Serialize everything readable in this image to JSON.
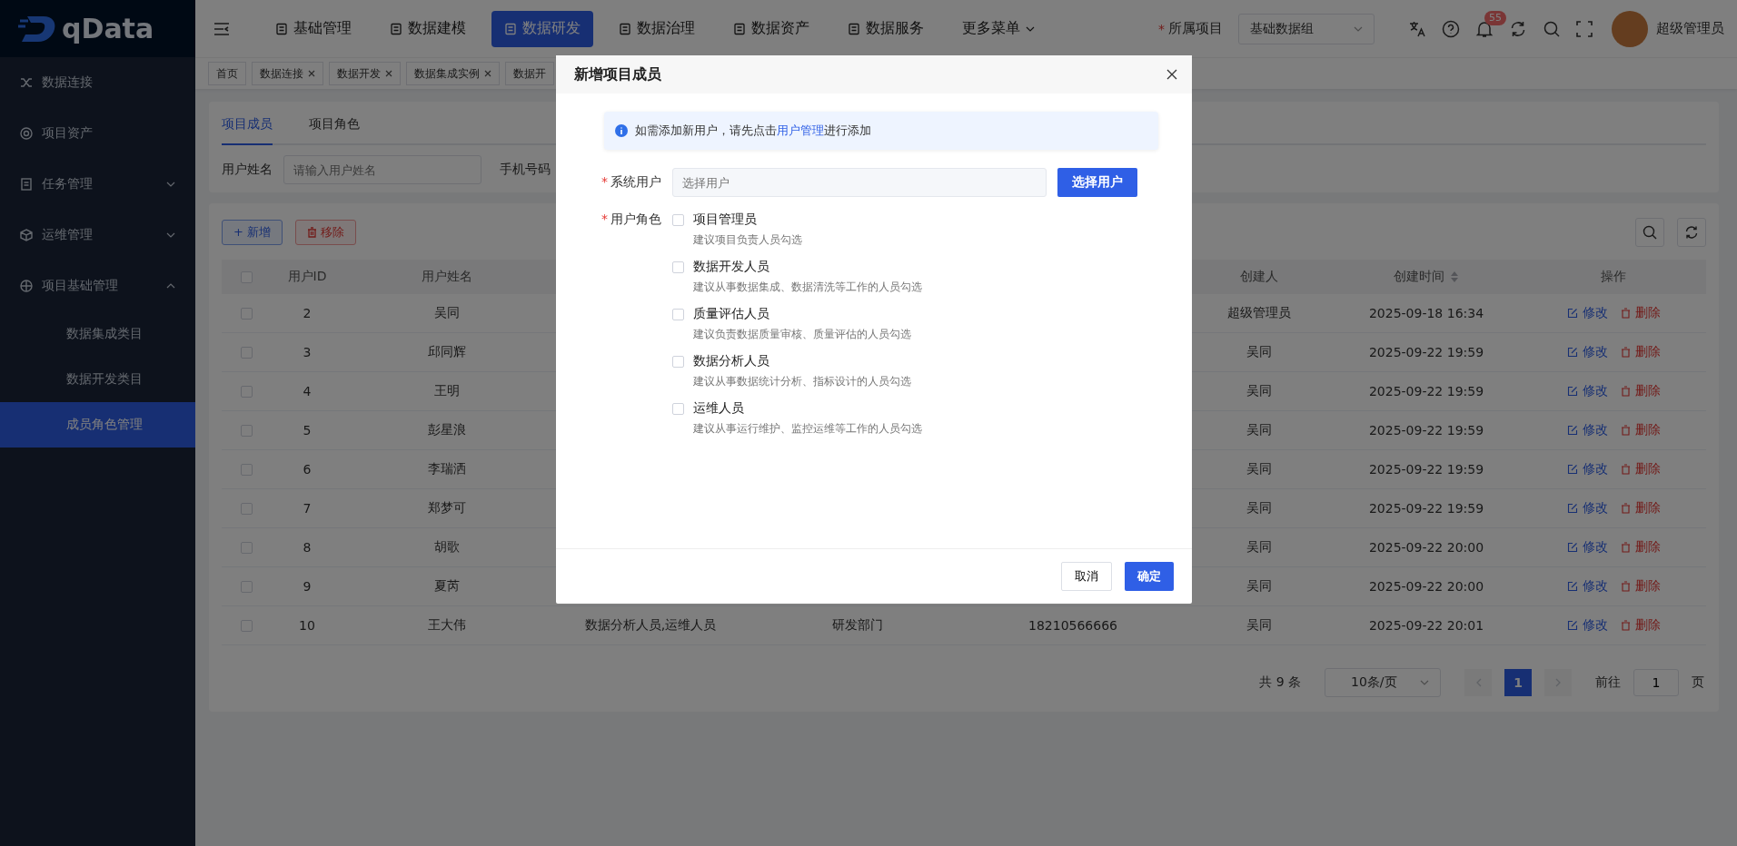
{
  "sidebar": {
    "logo": "qData",
    "items": [
      {
        "label": "数据连接",
        "selected": false
      },
      {
        "label": "项目资产",
        "selected": false
      },
      {
        "label": "任务管理",
        "selected": false,
        "expanded": false
      },
      {
        "label": "运维管理",
        "selected": false,
        "expanded": false
      },
      {
        "label": "项目基础管理",
        "selected": false,
        "expanded": true,
        "children": [
          {
            "label": "数据集成类目",
            "selected": false
          },
          {
            "label": "数据开发类目",
            "selected": false
          },
          {
            "label": "成员角色管理",
            "selected": true
          }
        ]
      }
    ]
  },
  "topbar": {
    "nav": [
      {
        "label": "基础管理",
        "selected": false
      },
      {
        "label": "数据建模",
        "selected": false
      },
      {
        "label": "数据研发",
        "selected": true
      },
      {
        "label": "数据治理",
        "selected": false
      },
      {
        "label": "数据资产",
        "selected": false
      },
      {
        "label": "数据服务",
        "selected": false
      },
      {
        "label": "更多菜单",
        "selected": false,
        "dropdown": true
      }
    ],
    "project_required_mark": "*",
    "project_label": "所属项目",
    "project_value": "基础数据组",
    "notification_badge": "55",
    "user_name": "超级管理员"
  },
  "tags": [
    {
      "label": "首页",
      "closable": false
    },
    {
      "label": "数据连接",
      "closable": true
    },
    {
      "label": "数据开发",
      "closable": true
    },
    {
      "label": "数据集成实例",
      "closable": true
    },
    {
      "label": "数据开",
      "closable": false
    }
  ],
  "filters": {
    "tabs": [
      {
        "label": "项目成员",
        "selected": true
      },
      {
        "label": "项目角色",
        "selected": false
      }
    ],
    "fields": [
      {
        "label": "用户姓名",
        "placeholder": "请输入用户姓名"
      },
      {
        "label": "手机号码"
      }
    ]
  },
  "toolbar": {
    "add": "+ 新增",
    "remove": "移除"
  },
  "table": {
    "select_all_checked": false,
    "columns": [
      {
        "label": "用户ID",
        "sortable": false
      },
      {
        "label": "用户姓名",
        "sortable": false
      },
      {
        "label": "创建人",
        "sortable": false
      },
      {
        "label": "创建时间",
        "sortable": true
      },
      {
        "label": "操作",
        "sortable": false
      }
    ],
    "rows": [
      {
        "checked": false,
        "user_id": "2",
        "user_name": "吴同",
        "creator": "超级管理员",
        "created_at": "2025-09-18 16:34",
        "actions": [
          "修改",
          "删除"
        ]
      },
      {
        "checked": false,
        "user_id": "3",
        "user_name": "邱同辉",
        "creator": "吴同",
        "created_at": "2025-09-22 19:59",
        "actions": [
          "修改",
          "删除"
        ]
      },
      {
        "checked": false,
        "user_id": "4",
        "user_name": "王明",
        "creator": "吴同",
        "created_at": "2025-09-22 19:59",
        "actions": [
          "修改",
          "删除"
        ]
      },
      {
        "checked": false,
        "user_id": "5",
        "user_name": "彭星浪",
        "creator": "吴同",
        "created_at": "2025-09-22 19:59",
        "actions": [
          "修改",
          "删除"
        ]
      },
      {
        "checked": false,
        "user_id": "6",
        "user_name": "李瑞洒",
        "creator": "吴同",
        "created_at": "2025-09-22 19:59",
        "actions": [
          "修改",
          "删除"
        ]
      },
      {
        "checked": false,
        "user_id": "7",
        "user_name": "郑梦可",
        "creator": "吴同",
        "created_at": "2025-09-22 19:59",
        "actions": [
          "修改",
          "删除"
        ]
      },
      {
        "checked": false,
        "user_id": "8",
        "user_name": "胡歌",
        "creator": "吴同",
        "created_at": "2025-09-22 20:00",
        "actions": [
          "修改",
          "删除"
        ]
      },
      {
        "checked": false,
        "user_id": "9",
        "user_name": "夏芮",
        "creator": "吴同",
        "created_at": "2025-09-22 20:00",
        "actions": [
          "修改",
          "删除"
        ]
      },
      {
        "checked": false,
        "user_id": "10",
        "user_name": "王大伟",
        "column_3": "数据分析人员,运维人员",
        "column_4": "研发部门",
        "column_5": "18210566666",
        "creator": "吴同",
        "created_at": "2025-09-22 20:01",
        "actions": [
          "修改",
          "删除"
        ]
      }
    ]
  },
  "pagination": {
    "total": "共 9 条",
    "page_size": "10条/页",
    "prev_disabled": true,
    "next_disabled": true,
    "pages": [
      {
        "label": "1",
        "selected": true
      }
    ],
    "goto_label": "前往",
    "goto_value": "1",
    "page_suffix": "页"
  },
  "modal": {
    "title": "新增项目成员",
    "alert": {
      "text_before": "如需添加新用户，请先点击",
      "link": "用户管理",
      "text_after": "进行添加"
    },
    "user_field": {
      "required_mark": "*",
      "label": "系统用户",
      "placeholder": "选择用户",
      "button": "选择用户"
    },
    "roles_field": {
      "required_mark": "*",
      "label": "用户角色",
      "options": [
        {
          "name": "项目管理员",
          "description": "建议项目负责人员勾选",
          "checked": false
        },
        {
          "name": "数据开发人员",
          "description": "建议从事数据集成、数据清洗等工作的人员勾选",
          "checked": false
        },
        {
          "name": "质量评估人员",
          "description": "建议负责数据质量审核、质量评估的人员勾选",
          "checked": false
        },
        {
          "name": "数据分析人员",
          "description": "建议从事数据统计分析、指标设计的人员勾选",
          "checked": false
        },
        {
          "name": "运维人员",
          "description": "建议从事运行维护、监控运维等工作的人员勾选",
          "checked": false
        }
      ]
    },
    "buttons": {
      "cancel": "取消",
      "confirm": "确定"
    }
  }
}
